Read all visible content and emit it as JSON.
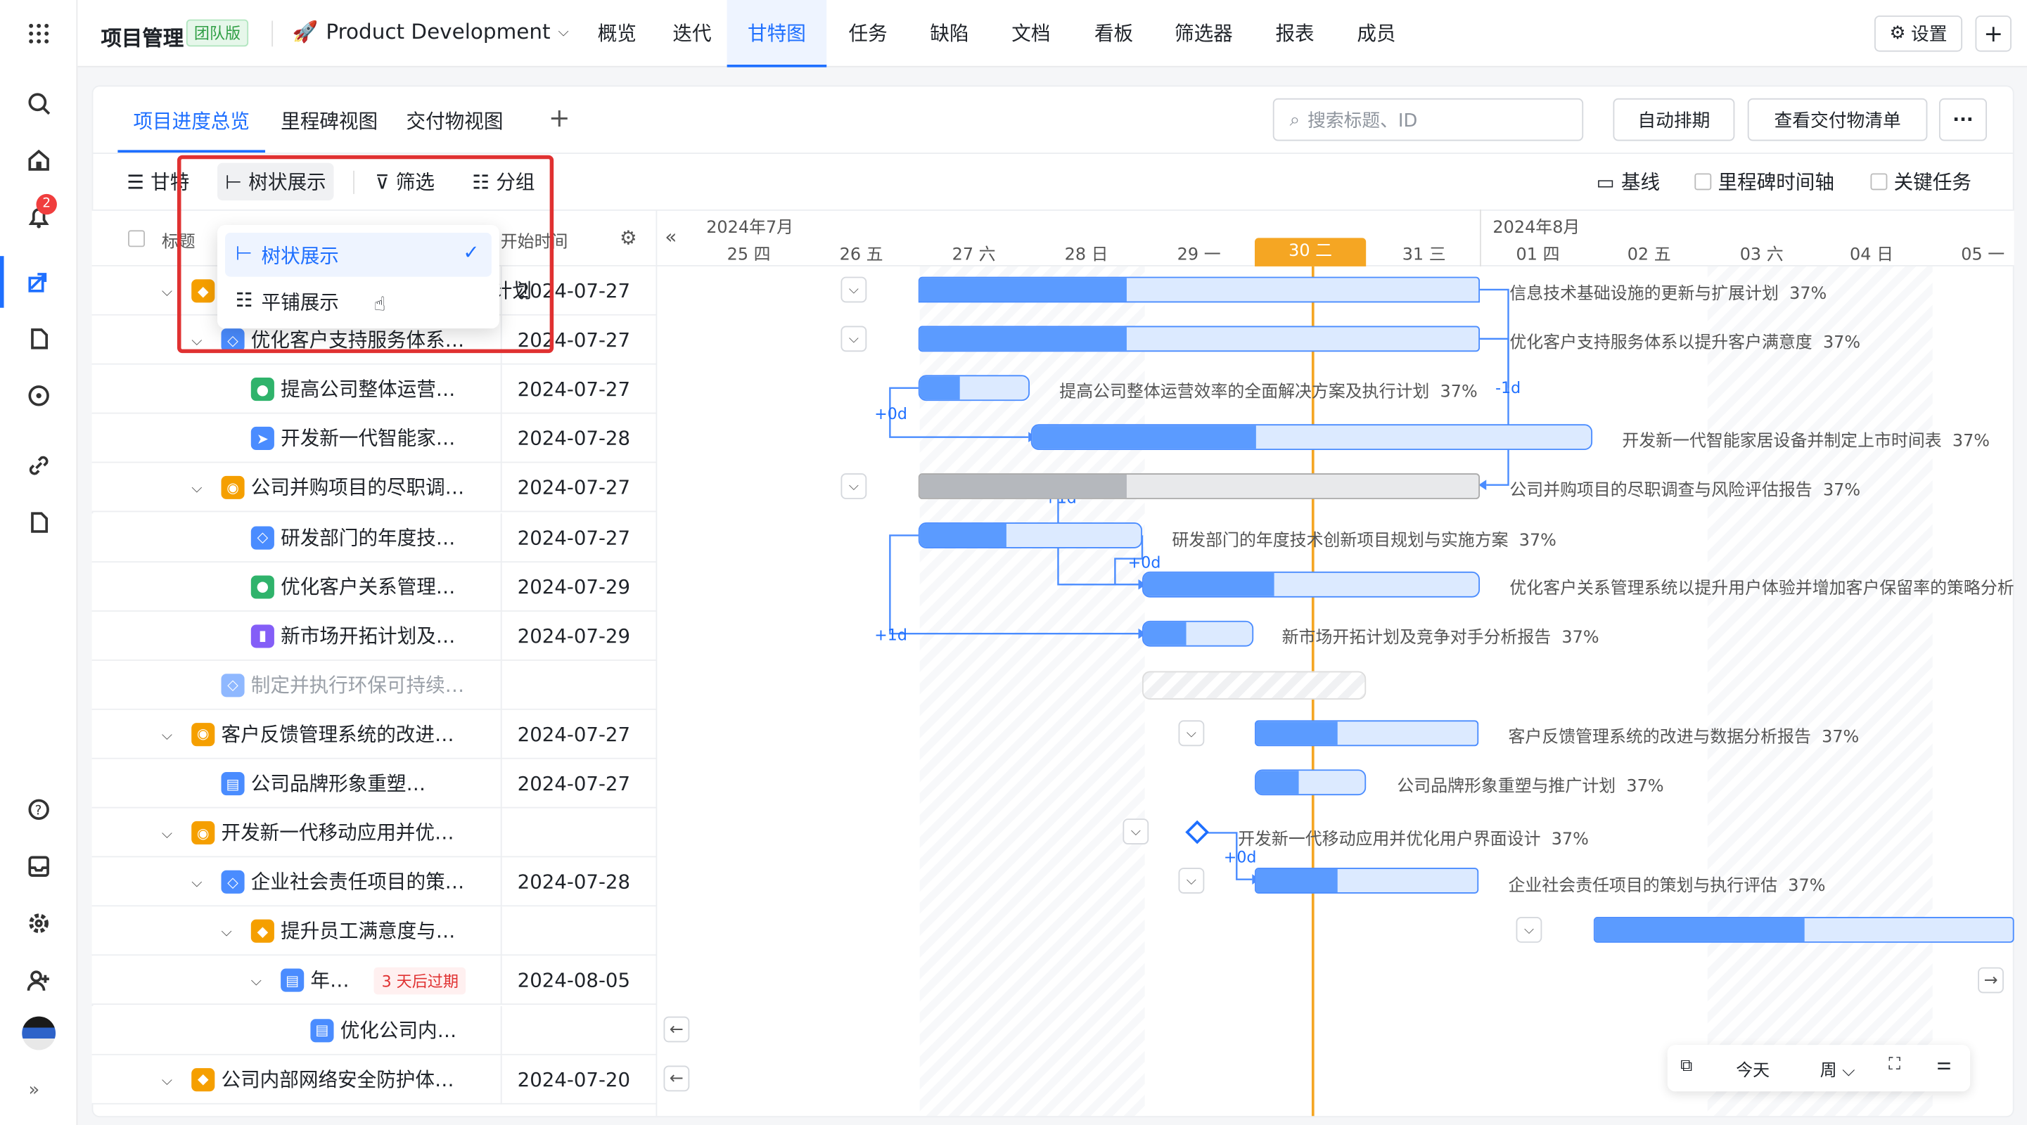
{
  "app": {
    "name": "项目管理",
    "edition": "团队版",
    "project": "Product Development",
    "notification_count": "2"
  },
  "nav": [
    "概览",
    "迭代",
    "甘特图",
    "任务",
    "缺陷",
    "文档",
    "看板",
    "筛选器",
    "报表",
    "成员"
  ],
  "settings_label": "设置",
  "views": {
    "tabs": [
      "项目进度总览",
      "里程碑视图",
      "交付物视图"
    ],
    "active": "项目进度总览"
  },
  "search": {
    "placeholder": "搜索标题、ID"
  },
  "actions": {
    "auto_schedule": "自动排期",
    "deliverables": "查看交付物清单"
  },
  "toolbar": {
    "gantt": "甘特",
    "tree": "树状展示",
    "filter": "筛选",
    "group": "分组",
    "baseline": "基线",
    "milestone_axis": "里程碑时间轴",
    "critical": "关键任务"
  },
  "dropdown": {
    "tree": "树状展示",
    "flat": "平铺展示"
  },
  "table": {
    "col_title": "标题",
    "col_start": "开始时间"
  },
  "rows": [
    {
      "title": "信息技术基础设施的更新与扩展计划",
      "date": "2024-07-27"
    },
    {
      "title": "优化客户支持服务体系…",
      "date": "2024-07-27"
    },
    {
      "title": "提高公司整体运营…",
      "date": "2024-07-27"
    },
    {
      "title": "开发新一代智能家…",
      "date": "2024-07-28"
    },
    {
      "title": "公司并购项目的尽职调…",
      "date": "2024-07-27"
    },
    {
      "title": "研发部门的年度技…",
      "date": "2024-07-27"
    },
    {
      "title": "优化客户关系管理…",
      "date": "2024-07-29"
    },
    {
      "title": "新市场开拓计划及…",
      "date": "2024-07-29"
    },
    {
      "title": "制定并执行环保可持续…",
      "date": ""
    },
    {
      "title": "客户反馈管理系统的改进…",
      "date": "2024-07-27"
    },
    {
      "title": "公司品牌形象重塑…",
      "date": "2024-07-27"
    },
    {
      "title": "开发新一代移动应用并优…",
      "date": ""
    },
    {
      "title": "企业社会责任项目的策…",
      "date": "2024-07-28"
    },
    {
      "title": "提升员工满意度与…",
      "date": ""
    },
    {
      "title": "年…",
      "date": "2024-08-05",
      "badge": "3 天后过期"
    },
    {
      "title": "优化公司内…",
      "date": ""
    },
    {
      "title": "公司内部网络安全防护体…",
      "date": "2024-07-20"
    }
  ],
  "timeline": {
    "months": [
      "2024年7月",
      "2024年8月"
    ],
    "days": [
      "25 四",
      "26 五",
      "27 六",
      "28 日",
      "29 一",
      "30 二",
      "31 三",
      "01 四",
      "02 五",
      "03 六",
      "04 日",
      "05 一"
    ],
    "today": "30 二"
  },
  "bars": [
    {
      "label": "信息技术基础设施的更新与扩展计划",
      "pct": "37%"
    },
    {
      "label": "优化客户支持服务体系以提升客户满意度",
      "pct": "37%"
    },
    {
      "label": "提高公司整体运营效率的全面解决方案及执行计划",
      "pct": "37%"
    },
    {
      "label": "开发新一代智能家居设备并制定上市时间表",
      "pct": "37%"
    },
    {
      "label": "公司并购项目的尽职调查与风险评估报告",
      "pct": "37%"
    },
    {
      "label": "研发部门的年度技术创新项目规划与实施方案",
      "pct": "37%"
    },
    {
      "label": "优化客户关系管理系统以提升用户体验并增加客户保留率的策略分析",
      "pct": ""
    },
    {
      "label": "新市场开拓计划及竞争对手分析报告",
      "pct": "37%"
    },
    {
      "label": "客户反馈管理系统的改进与数据分析报告",
      "pct": "37%"
    },
    {
      "label": "公司品牌形象重塑与推广计划",
      "pct": "37%"
    },
    {
      "label": "开发新一代移动应用并优化用户界面设计",
      "pct": "37%"
    },
    {
      "label": "企业社会责任项目的策划与执行评估",
      "pct": "37%"
    }
  ],
  "deps": [
    "+0d",
    "-1d",
    "+1d",
    "+0d",
    "+1d",
    "+0d"
  ],
  "bottom": {
    "today": "今天",
    "week": "周"
  },
  "colors": {
    "accent": "#1e6fff",
    "today_line": "#f5a623",
    "highlight_box": "#e03131"
  }
}
